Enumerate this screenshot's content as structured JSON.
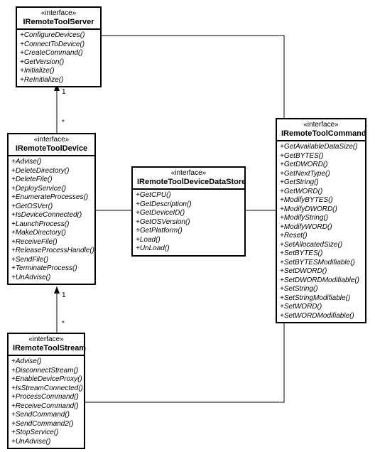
{
  "stereotype": "«interface»",
  "boxes": {
    "server": {
      "name": "IRemoteToolServer",
      "ops": [
        "+ConfigureDevices()",
        "+ConnectToDevice()",
        "+CreateCommand()",
        "+GetVersion()",
        "+Initialize()",
        "+ReInitialize()"
      ]
    },
    "device": {
      "name": "IRemoteToolDevice",
      "ops": [
        "+Advise()",
        "+DeleteDirectory()",
        "+DeleteFile()",
        "+DeployService()",
        "+EnumerateProcesses()",
        "+GetOSVer()",
        "+IsDeviceConnected()",
        "+LaunchProcess()",
        "+MakeDirectory()",
        "+ReceiveFile()",
        "+ReleaseProcessHandle()",
        "+SendFile()",
        "+TerminateProcess()",
        "+UnAdvise()"
      ]
    },
    "datastore": {
      "name": "IRemoteToolDeviceDataStore",
      "ops": [
        "+GetCPU()",
        "+GetDescription()",
        "+GetDeviceID()",
        "+GetOSVersion()",
        "+GetPlatform()",
        "+Load()",
        "+UnLoad()"
      ]
    },
    "command": {
      "name": "IRemoteToolCommand",
      "ops": [
        "+GetAvailableDataSize()",
        "+GetBYTES()",
        "+GetDWORD()",
        "+GetNextType()",
        "+GetString()",
        "+GetWORD()",
        "+ModifyBYTES()",
        "+ModifyDWORD()",
        "+ModifyString()",
        "+ModifyWORD()",
        "+Reset()",
        "+SetAllocatedSize()",
        "+SetBYTES()",
        "+SetBYTESModifiable()",
        "+SetDWORD()",
        "+SetDWORDModifiable()",
        "+SetString()",
        "+SetStringModifiable()",
        "+SetWORD()",
        "+SetWORDModifiable()"
      ]
    },
    "stream": {
      "name": "IRemoteToolStream",
      "ops": [
        "+Advise()",
        "+DisconnectStream()",
        "+EnableDeviceProxy()",
        "+IsStreamConnected()",
        "+ProcessCommand()",
        "+ReceiveCommand()",
        "+SendCommand()",
        "+SendCommand2()",
        "+StopService()",
        "+UnAdvise()"
      ]
    }
  },
  "mults": {
    "one": "1",
    "many": "*"
  }
}
